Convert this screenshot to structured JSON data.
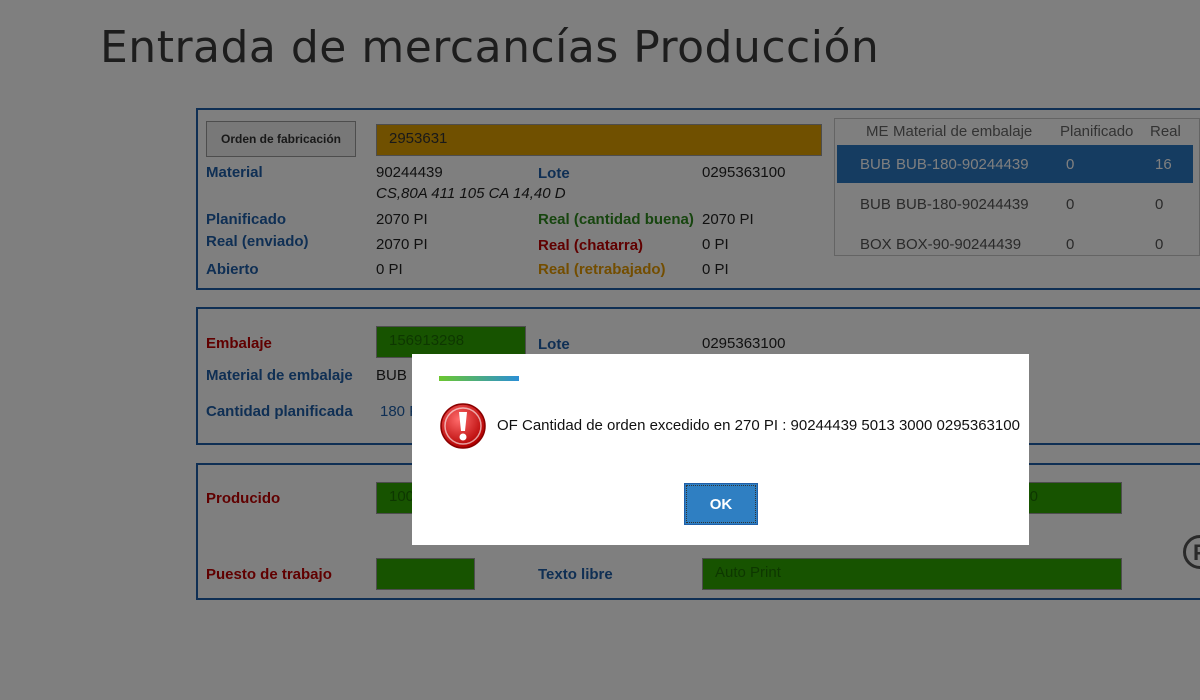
{
  "title": "Entrada de mercancías  Producción",
  "order": {
    "button_label": "Orden de fabricación",
    "order_value": "2953631",
    "material_label": "Material",
    "material_value": "90244439",
    "material_desc": "CS,80A 411 105 CA 14,40 D",
    "lote_label": "Lote",
    "lote_value": "0295363100",
    "planificado_label": "Planificado",
    "planificado_value": "2070 PI",
    "real_enviado_label": "Real (enviado)",
    "real_enviado_value": "2070 PI",
    "abierto_label": "Abierto",
    "abierto_value": "0 PI",
    "real_buena_label": "Real (cantidad buena)",
    "real_buena_value": "2070 PI",
    "real_chatarra_label": "Real (chatarra)",
    "real_chatarra_value": "0 PI",
    "real_retrabajado_label": "Real (retrabajado)",
    "real_retrabajado_value": "0 PI"
  },
  "packaging_grid": {
    "headers": [
      "ME",
      "Material de embalaje",
      "Planificado",
      "Real"
    ],
    "rows": [
      {
        "me": "BUB",
        "material": "BUB-180-90244439",
        "planificado": "0",
        "real": "16",
        "selected": true
      },
      {
        "me": "BUB",
        "material": "BUB-180-90244439",
        "planificado": "0",
        "real": "0",
        "selected": false
      },
      {
        "me": "BOX",
        "material": "BOX-90-90244439",
        "planificado": "0",
        "real": "0",
        "selected": false
      }
    ]
  },
  "packaging": {
    "embalaje_label": "Embalaje",
    "embalaje_value": "156913298",
    "lote_label": "Lote",
    "lote_value": "0295363100",
    "material_embalaje_label": "Material de embalaje",
    "material_embalaje_value": "BUB",
    "cantidad_planificada_label": "Cantidad planificada",
    "cantidad_planificada_value": "180 P"
  },
  "production": {
    "producido_label": "Producido",
    "producido_value": "100",
    "right_field_value": "380",
    "puesto_label": "Puesto de trabajo",
    "puesto_value": "",
    "texto_libre_label": "Texto libre",
    "texto_libre_value": "Auto Print",
    "side_icon_letter": "P"
  },
  "dialog": {
    "message": "OF Cantidad de orden excedido en 270 PI : 90244439 5013 3000 0295363100",
    "ok_label": "OK"
  },
  "colors": {
    "accent_blue": "#1f5fa8",
    "field_orange": "#e0a000",
    "field_green": "#2fa600",
    "selected_row": "#2b78c2",
    "error_red": "#c00000"
  }
}
